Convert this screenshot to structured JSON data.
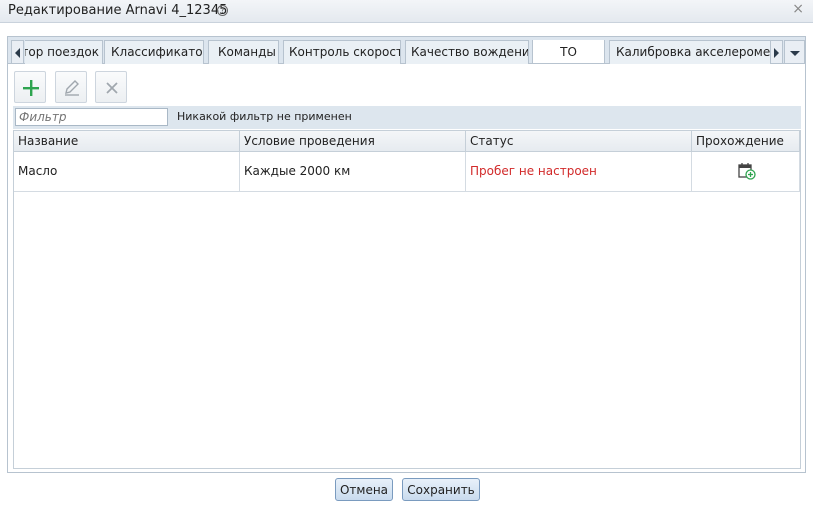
{
  "window": {
    "title": "Редактирование Arnavi 4_12345",
    "help_glyph": "?",
    "close_glyph": "×"
  },
  "tabs": [
    {
      "label": "Детектор поездок"
    },
    {
      "label": "Классификатор"
    },
    {
      "label": "Команды"
    },
    {
      "label": "Контроль скорости"
    },
    {
      "label": "Качество вождения"
    },
    {
      "label": "ТО"
    },
    {
      "label": "Калибровка акселерометра"
    }
  ],
  "active_tab": "ТО",
  "toolbar": {
    "add_icon": "plus-icon",
    "edit_icon": "pencil-icon",
    "delete_icon": "cross-icon"
  },
  "filter": {
    "placeholder": "Фильтр",
    "value": "",
    "status": "Никакой фильтр не применен"
  },
  "grid": {
    "columns": [
      "Название",
      "Условие проведения",
      "Статус",
      "Прохождение"
    ],
    "rows": [
      {
        "name": "Масло",
        "condition": "Каждые 2000 км",
        "status": "Пробег не настроен",
        "pass_icon": "calendar-add-icon"
      }
    ]
  },
  "colors": {
    "status_error": "#d22a2a",
    "add_icon": "#2ea44f",
    "header_bg": "#dde6ee"
  },
  "footer": {
    "cancel": "Отмена",
    "save": "Сохранить"
  }
}
